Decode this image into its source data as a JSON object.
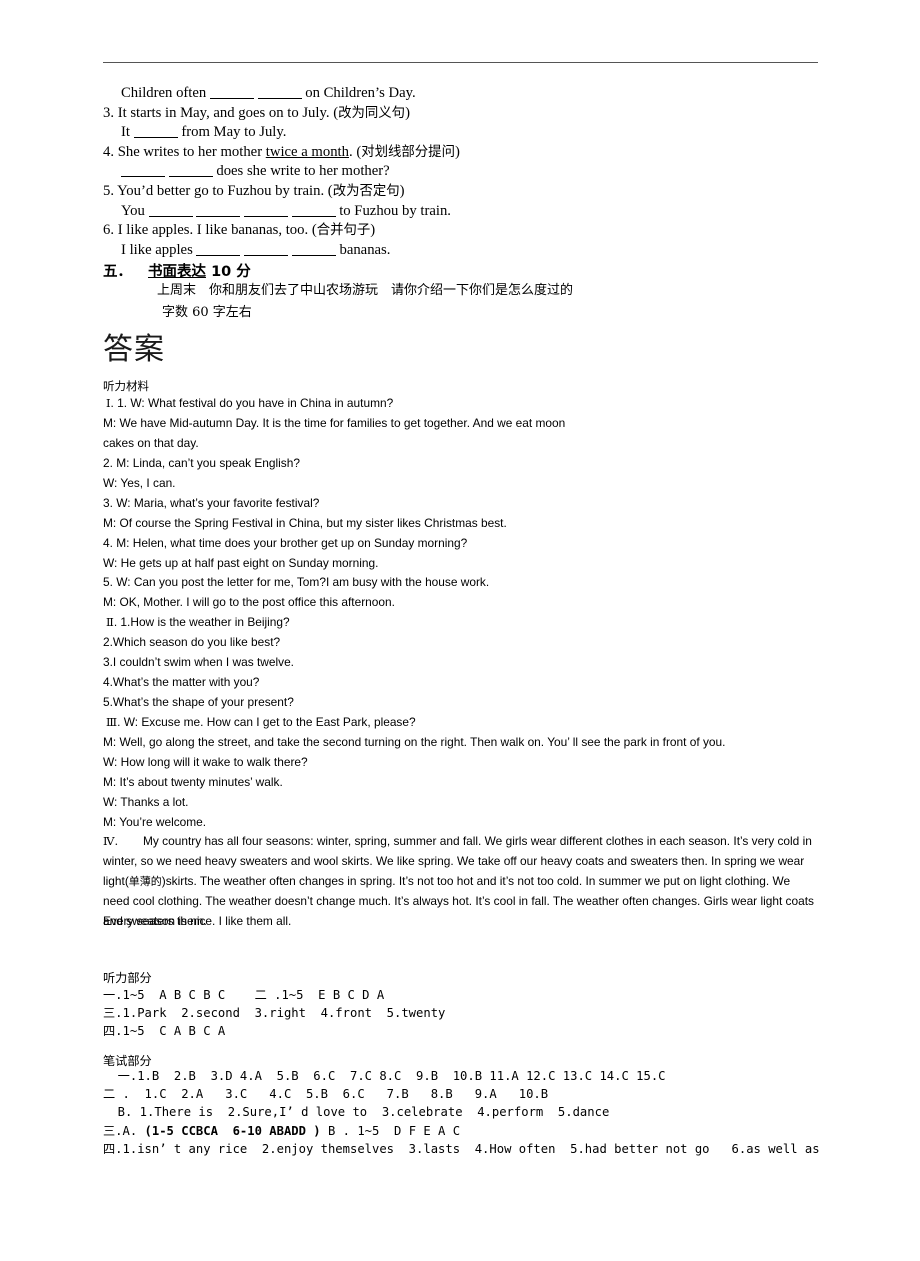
{
  "document": {
    "type": "exam-paper-answer-key",
    "language": "zh-CN/en"
  },
  "exercises": {
    "lines": [
      {
        "id": "ex-2-answer",
        "indent": true,
        "parts": [
          {
            "t": "text",
            "v": "Children often "
          },
          {
            "t": "blank",
            "size": "md"
          },
          {
            "t": "text",
            "v": "   "
          },
          {
            "t": "blank",
            "size": "md"
          },
          {
            "t": "text",
            "v": " on Children’s Day."
          }
        ]
      },
      {
        "id": "ex-3",
        "indent": false,
        "parts": [
          {
            "t": "text",
            "v": "3. It starts in May, and goes on to July. ("
          },
          {
            "t": "cn",
            "v": "改为同义句"
          },
          {
            "t": "text",
            "v": ")"
          }
        ]
      },
      {
        "id": "ex-3-answer",
        "indent": true,
        "parts": [
          {
            "t": "text",
            "v": "It "
          },
          {
            "t": "blank",
            "size": "md"
          },
          {
            "t": "text",
            "v": " from May to July."
          }
        ]
      },
      {
        "id": "ex-4",
        "indent": false,
        "parts": [
          {
            "t": "text",
            "v": "4. She writes to her mother "
          },
          {
            "t": "underline",
            "v": "twice a month"
          },
          {
            "t": "text",
            "v": ". ("
          },
          {
            "t": "cn",
            "v": "对划线部分提问"
          },
          {
            "t": "text",
            "v": ")"
          }
        ]
      },
      {
        "id": "ex-4-answer",
        "indent": true,
        "parts": [
          {
            "t": "blank",
            "size": "md"
          },
          {
            "t": "text",
            "v": " "
          },
          {
            "t": "blank",
            "size": "md"
          },
          {
            "t": "text",
            "v": " does she write to her mother?"
          }
        ]
      },
      {
        "id": "ex-5",
        "indent": false,
        "parts": [
          {
            "t": "text",
            "v": "5. You’d better go to Fuzhou by train. ("
          },
          {
            "t": "cn",
            "v": "改为否定句"
          },
          {
            "t": "text",
            "v": ")"
          }
        ]
      },
      {
        "id": "ex-5-answer",
        "indent": true,
        "parts": [
          {
            "t": "text",
            "v": "You "
          },
          {
            "t": "blank",
            "size": "md"
          },
          {
            "t": "text",
            "v": " "
          },
          {
            "t": "blank",
            "size": "md"
          },
          {
            "t": "text",
            "v": " "
          },
          {
            "t": "blank",
            "size": "md"
          },
          {
            "t": "text",
            "v": " "
          },
          {
            "t": "blank",
            "size": "md"
          },
          {
            "t": "text",
            "v": " to Fuzhou by train."
          }
        ]
      },
      {
        "id": "ex-6",
        "indent": false,
        "parts": [
          {
            "t": "text",
            "v": "6. I like apples. I like bananas, too. ("
          },
          {
            "t": "cn",
            "v": "合并句子"
          },
          {
            "t": "text",
            "v": ")"
          }
        ]
      },
      {
        "id": "ex-6-answer",
        "indent": true,
        "parts": [
          {
            "t": "text",
            "v": "I like apples "
          },
          {
            "t": "blank",
            "size": "md"
          },
          {
            "t": "text",
            "v": " "
          },
          {
            "t": "blank",
            "size": "md"
          },
          {
            "t": "text",
            "v": " "
          },
          {
            "t": "blank",
            "size": "md"
          },
          {
            "t": "text",
            "v": " bananas."
          }
        ]
      }
    ]
  },
  "section5": {
    "number": "五．",
    "title": "书面表达",
    "points": "10 分",
    "prompt_line1": "上周末　你和朋友们去了中山农场游玩　请你介绍一下你们是怎么度过的",
    "prompt_line2": "字数 60 字左右"
  },
  "answers_heading": "答案",
  "listening_material": {
    "heading": "听力材料",
    "lines": [
      {
        "roman": "Ⅰ",
        "text": ". 1. W: What festival do you have in China in autumn?"
      },
      {
        "roman": "",
        "text": "M: We have Mid-autumn Day. It is the time for families to get together. And we eat moon"
      },
      {
        "roman": "",
        "text": "cakes on that day."
      },
      {
        "roman": "",
        "text": "2. M: Linda, can’t you speak English?"
      },
      {
        "roman": "",
        "text": "W: Yes, I can."
      },
      {
        "roman": "",
        "text": "3. W: Maria, what’s your favorite festival?"
      },
      {
        "roman": "",
        "text": "M: Of course the Spring Festival in China, but my sister likes Christmas best."
      },
      {
        "roman": "",
        "text": "4. M: Helen, what time does your brother get up on Sunday morning?"
      },
      {
        "roman": "",
        "text": "W: He gets up at half past eight on Sunday morning."
      },
      {
        "roman": "",
        "text": "5. W: Can you post the letter for me, Tom?I am busy with the house work."
      },
      {
        "roman": "",
        "text": "M: OK, Mother. I will go to the post office this afternoon."
      },
      {
        "roman": "Ⅱ",
        "text": ". 1.How is the weather in Beijing?"
      },
      {
        "roman": "",
        "text": "2.Which season do you like best?"
      },
      {
        "roman": "",
        "text": "3.I couldn’t swim when I was twelve."
      },
      {
        "roman": "",
        "text": "4.What’s the matter with you?"
      },
      {
        "roman": "",
        "text": "5.What’s the shape of your present?"
      },
      {
        "roman": "Ⅲ",
        "text": ". W: Excuse me. How can I get to the East Park, please?"
      },
      {
        "roman": "",
        "text": "M: Well, go along the street, and take the second turning on the right. Then walk on. You’ ll see the park in front of you."
      },
      {
        "roman": "",
        "text": "W: How long will it wake to walk there?"
      },
      {
        "roman": "",
        "text": "M: It’s about twenty minutes’ walk."
      },
      {
        "roman": "",
        "text": "W: Thanks a lot."
      },
      {
        "roman": "",
        "text": "M: You’re welcome."
      }
    ],
    "paragraph4": {
      "roman": "Ⅳ",
      "text_before_cn": "My country has all four seasons: winter, spring, summer and fall. We girls wear different clothes in each season. It’s very cold in winter, so we need heavy sweaters and wool skirts. We like spring. We take off our heavy coats and sweaters then. In spring we wear light(",
      "cn_gloss": "单薄的",
      "text_after_cn": ")skirts. The weather often changes in spring. It’s not too hot and it’s not too cold. In summer we put on light clothing. We need cool clothing. The weather doesn’t change much. It’s always hot. It’s cool in fall. The weather often changes. Girls wear light coats and sweaters them.",
      "closing": "Every season is nice. I like them all."
    }
  },
  "answer_key": {
    "listening_heading": "听力部分",
    "listening_lines": [
      "一.1~5  A B C B C    二 .1~5  E B C D A",
      "三.1.Park  2.second  3.right  4.front  5.twenty",
      "四.1~5  C A B C A"
    ],
    "written_heading": "笔试部分",
    "written_lines": [
      {
        "id": "written-1",
        "segments": [
          {
            "bold": false,
            "v": "  一.1.B  2.B  3.D 4.A  5.B  6.C  7.C 8.C  9.B  10.B 11.A 12.C 13.C 14.C 15.C"
          }
        ]
      },
      {
        "id": "written-2",
        "segments": [
          {
            "bold": false,
            "v": "二 .  1.C  2.A   3.C   4.C  5.B  6.C   7.B   8.B   9.A   10.B"
          }
        ]
      },
      {
        "id": "written-2b",
        "segments": [
          {
            "bold": false,
            "v": "  B. 1.There is  2.Sure,I’ d love to  3.celebrate  4.perform  5.dance"
          }
        ]
      },
      {
        "id": "written-3",
        "segments": [
          {
            "bold": false,
            "v": "三.A. "
          },
          {
            "bold": true,
            "v": "(1-5 CCBCA  6-10 ABADD )"
          },
          {
            "bold": false,
            "v": " B . 1~5  D F E A C"
          }
        ]
      },
      {
        "id": "written-4",
        "segments": [
          {
            "bold": false,
            "v": "四.1.isn’ t any rice  2.enjoy themselves  3.lasts  4.How often  5.had better not go   6.as well as"
          }
        ]
      }
    ]
  }
}
